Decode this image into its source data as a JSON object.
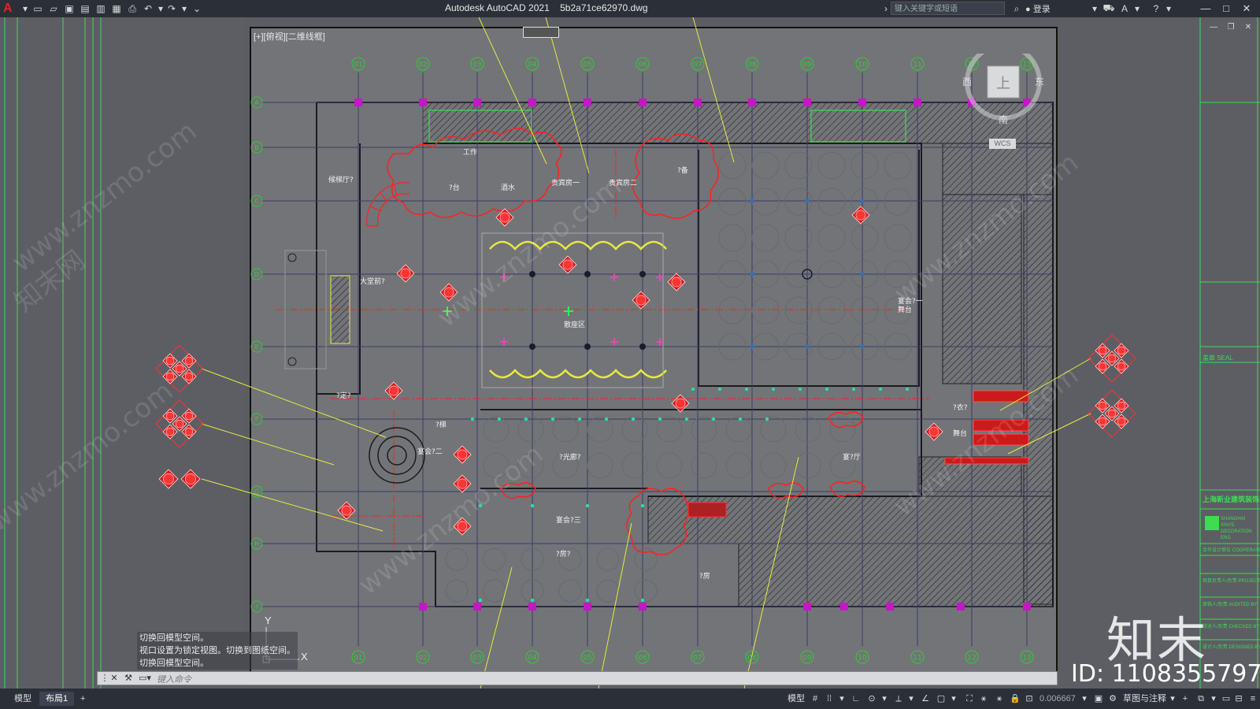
{
  "app": {
    "logo": "A",
    "title": "Autodesk AutoCAD 2021",
    "filename": "5b2a71ce62970.dwg",
    "search_placeholder": "键入关键字或短语",
    "login_label": "登录"
  },
  "viewport": {
    "label": "[+][俯视][二维线框]",
    "wcs_label": "WCS",
    "axis_x": "X",
    "axis_y": "Y"
  },
  "navcube": {
    "north": "北",
    "south": "南",
    "east": "东",
    "west": "西",
    "top": "上"
  },
  "grid": {
    "columns": [
      "01",
      "02",
      "03",
      "04",
      "05",
      "06",
      "07",
      "08",
      "09",
      "10",
      "11",
      "12",
      "13"
    ],
    "rows": [
      "A",
      "B",
      "C",
      "D",
      "E",
      "F",
      "G",
      "H",
      "I"
    ]
  },
  "rooms": [
    {
      "label": "工作"
    },
    {
      "label": "?台"
    },
    {
      "label": "酒水"
    },
    {
      "label": "贵宾房一"
    },
    {
      "label": "贵宾房二"
    },
    {
      "label": "?备"
    },
    {
      "label": "候梯厅?"
    },
    {
      "label": "大堂前?"
    },
    {
      "label": "散座区"
    },
    {
      "label": "宴会?一"
    },
    {
      "label": "舞台"
    },
    {
      "label": "?定?"
    },
    {
      "label": "?梯"
    },
    {
      "label": "宴会?二"
    },
    {
      "label": "?光廊?"
    },
    {
      "label": "宴会?三"
    },
    {
      "label": "?房?"
    },
    {
      "label": "?衣?"
    },
    {
      "label": "舞台"
    },
    {
      "label": "宴?厅"
    },
    {
      "label": "?房"
    }
  ],
  "command_history": [
    "切换回模型空间。",
    "视口设置为锁定视图。切换到图纸空间。",
    "切换回模型空间。"
  ],
  "command_input_placeholder": "键入命令",
  "layout_tabs": [
    "模型",
    "布局1",
    "+"
  ],
  "status": {
    "model_label": "模型",
    "scale": "0.006667",
    "workspace": "草图与注释"
  },
  "title_block": {
    "seal": "盖章 SEAL",
    "company": "上海新业建筑装饰工程",
    "company_en": "SHANGHAI XINYE DECORATION ENG",
    "rows": [
      "合作设计单位 COOPERATE",
      "项目负责人/负责 PROJECT",
      "审核人/负责 AUDITED BY",
      "校对人/负责 CHECKED BY",
      "设计人/负责 DESIGNED BY"
    ]
  },
  "watermark": {
    "brand": "知末",
    "site": "www.znzmo.com",
    "site_cn": "知末网",
    "id": "ID: 1108355797"
  },
  "colors": {
    "background": "#5b5d63",
    "paper": "#727478",
    "grid_line": "#3a3d66",
    "axis_bubble": "#33cc33",
    "column": "#c418c4",
    "red_ann": "#ff2020",
    "yellow": "#e8e840",
    "green_border": "#3ddc52",
    "wall": "#222"
  }
}
